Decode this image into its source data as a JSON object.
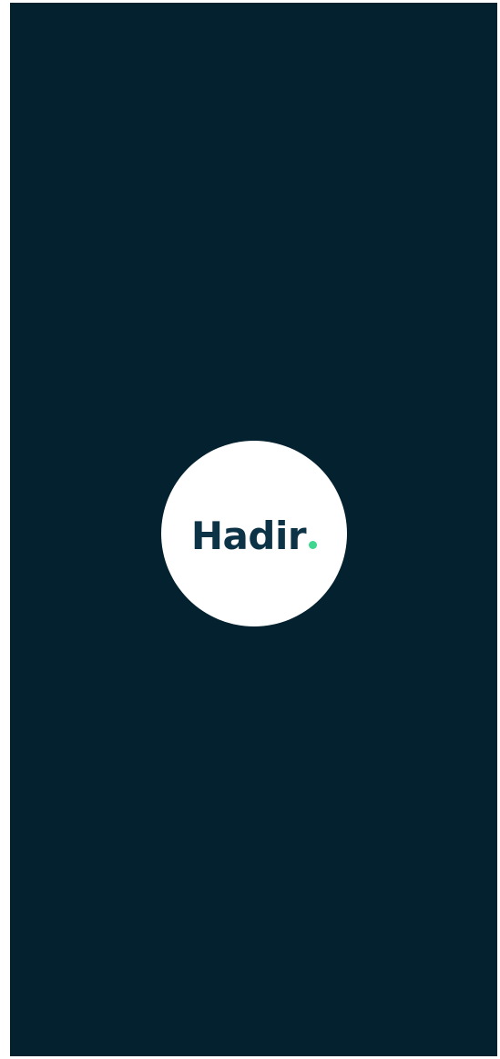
{
  "app": {
    "logo_text": "Hadir",
    "logo_dot_color": "#3fd68f",
    "background_color": "#03212f",
    "logo_text_color": "#0d3347"
  }
}
